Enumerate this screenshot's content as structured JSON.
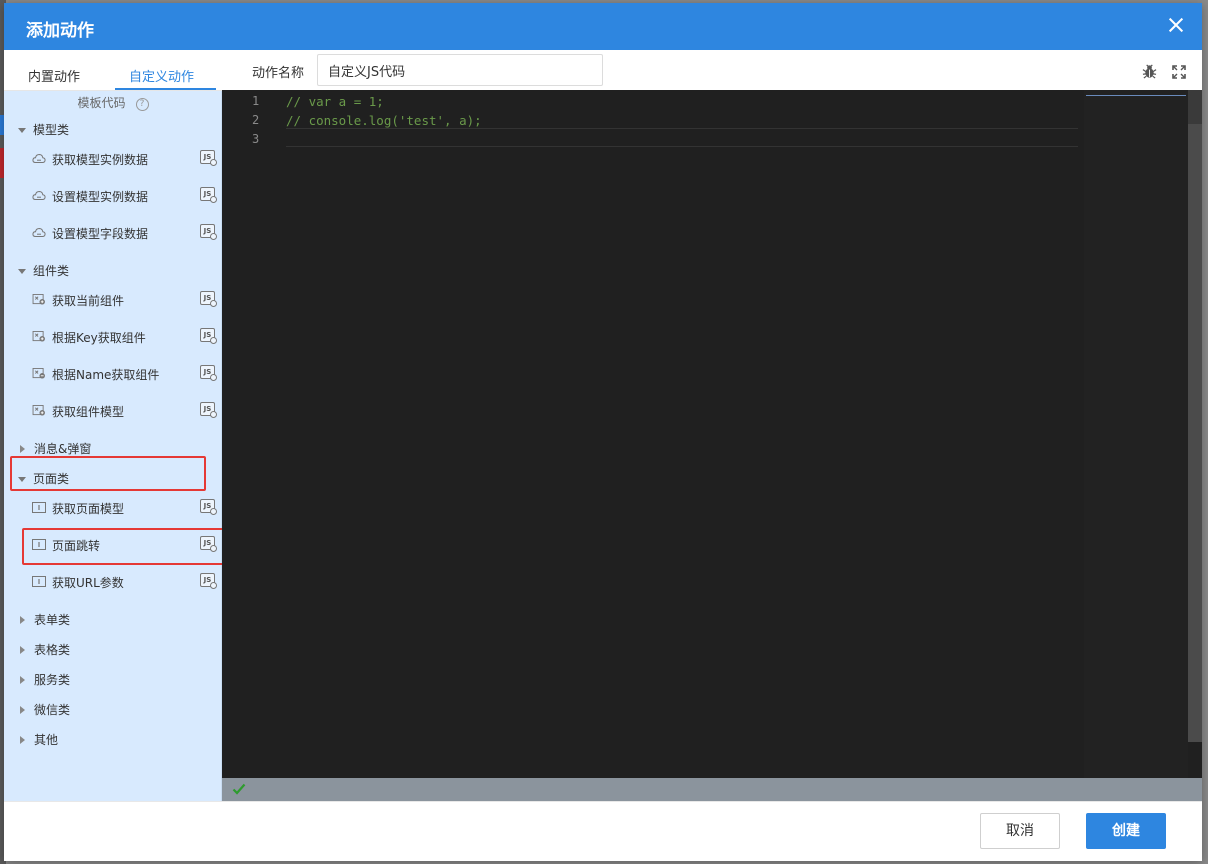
{
  "dialog": {
    "title": "添加动作"
  },
  "tabs": [
    {
      "label": "内置动作"
    },
    {
      "label": "自定义动作"
    }
  ],
  "template_header": {
    "label": "模板代码",
    "help": "?"
  },
  "tree": {
    "categories": [
      {
        "label": "模型类",
        "expanded": true,
        "items": [
          {
            "label": "获取模型实例数据",
            "icon": "cloud-icon",
            "badge": "JS"
          },
          {
            "label": "设置模型实例数据",
            "icon": "cloud-icon",
            "badge": "JS"
          },
          {
            "label": "设置模型字段数据",
            "icon": "cloud-icon",
            "badge": "JS"
          }
        ]
      },
      {
        "label": "组件类",
        "expanded": true,
        "items": [
          {
            "label": "获取当前组件",
            "icon": "component-icon",
            "badge": "JS"
          },
          {
            "label": "根据Key获取组件",
            "icon": "component-icon",
            "badge": "JS"
          },
          {
            "label": "根据Name获取组件",
            "icon": "component-icon",
            "badge": "JS"
          },
          {
            "label": "获取组件模型",
            "icon": "component-icon",
            "badge": "JS"
          }
        ]
      },
      {
        "label": "消息&弹窗",
        "expanded": false,
        "items": []
      },
      {
        "label": "页面类",
        "expanded": true,
        "items": [
          {
            "label": "获取页面模型",
            "icon": "page-icon",
            "badge": "JS"
          },
          {
            "label": "页面跳转",
            "icon": "page-icon",
            "badge": "JS"
          },
          {
            "label": "获取URL参数",
            "icon": "page-icon",
            "badge": "JS"
          }
        ]
      },
      {
        "label": "表单类",
        "expanded": false,
        "items": []
      },
      {
        "label": "表格类",
        "expanded": false,
        "items": []
      },
      {
        "label": "服务类",
        "expanded": false,
        "items": []
      },
      {
        "label": "微信类",
        "expanded": false,
        "items": []
      },
      {
        "label": "其他",
        "expanded": false,
        "items": []
      }
    ]
  },
  "action_name": {
    "label": "动作名称",
    "value": "自定义JS代码"
  },
  "editor": {
    "lines": [
      {
        "number": "1",
        "text": "// var a = 1;"
      },
      {
        "number": "2",
        "text": "// console.log('test', a);"
      },
      {
        "number": "3",
        "text": ""
      }
    ]
  },
  "footer": {
    "cancel_label": "取消",
    "create_label": "创建"
  },
  "colors": {
    "accent": "#2e86e0",
    "sidebar_bg": "#d8eafe",
    "editor_bg": "#202020",
    "code_comment": "#6a9a4a",
    "highlight": "#e53935",
    "status_ok": "#2e9b2e"
  }
}
